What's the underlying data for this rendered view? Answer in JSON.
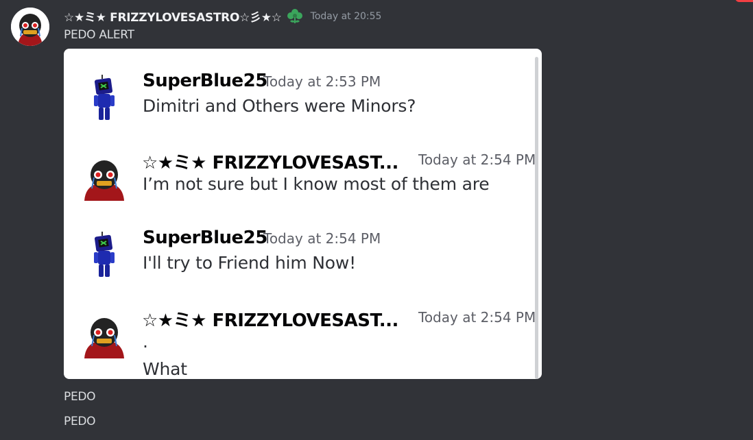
{
  "message": {
    "author": "☆★ミ★ FRIZZYLOVESASTRO☆彡★☆",
    "role_icon": "green-flower-role-icon",
    "timestamp": "Today at 20:55",
    "first_line": "PEDO ALERT",
    "after_lines": [
      "PEDO",
      "PEDO"
    ]
  },
  "attachment": {
    "messages": [
      {
        "author": "SuperBlue25",
        "time": "Today at 2:53 PM",
        "lines": [
          "Dimitri and Others were Minors?"
        ],
        "avatar": "blue-robot-avatar"
      },
      {
        "author": "☆★ミ★ FRIZZYLOVESAST...",
        "time": "Today at 2:54 PM",
        "lines": [
          "I’m not sure but I know most of them are"
        ],
        "avatar": "masked-character-avatar"
      },
      {
        "author": "SuperBlue25",
        "time": "Today at 2:54 PM",
        "lines": [
          "I'll try to Friend him Now!"
        ],
        "avatar": "blue-robot-avatar"
      },
      {
        "author": "☆★ミ★ FRIZZYLOVESAST...",
        "time": "Today at 2:54 PM",
        "lines": [
          ".",
          "What"
        ],
        "avatar": "masked-character-avatar"
      }
    ]
  },
  "colors": {
    "background": "#313338",
    "accent_red": "#f23f43",
    "role_green": "#3ba55c"
  }
}
